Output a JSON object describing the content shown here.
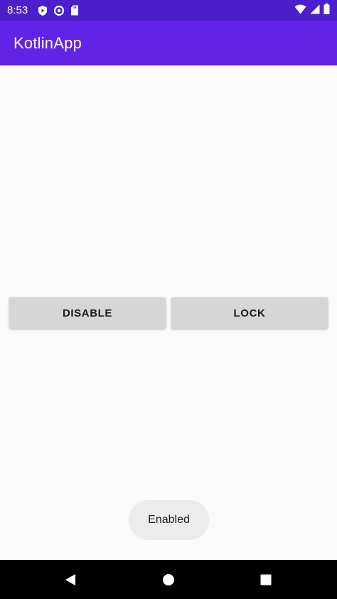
{
  "status_bar": {
    "time": "8:53",
    "left_icons": [
      "play-protect-icon",
      "data-saver-icon",
      "sd-card-icon"
    ],
    "right_icons": [
      "wifi-icon",
      "signal-icon",
      "battery-icon"
    ]
  },
  "app_bar": {
    "title": "KotlinApp"
  },
  "main": {
    "disable_label": "DISABLE",
    "lock_label": "LOCK"
  },
  "toast": {
    "message": "Enabled"
  },
  "nav_bar": {
    "buttons": [
      "back-icon",
      "home-icon",
      "recents-icon"
    ]
  },
  "colors": {
    "status_bar": "#4c1fcc",
    "app_bar": "#6223e6",
    "background": "#fafafa",
    "button": "#d6d6d6",
    "toast": "#ececec",
    "nav_bar": "#000000"
  }
}
